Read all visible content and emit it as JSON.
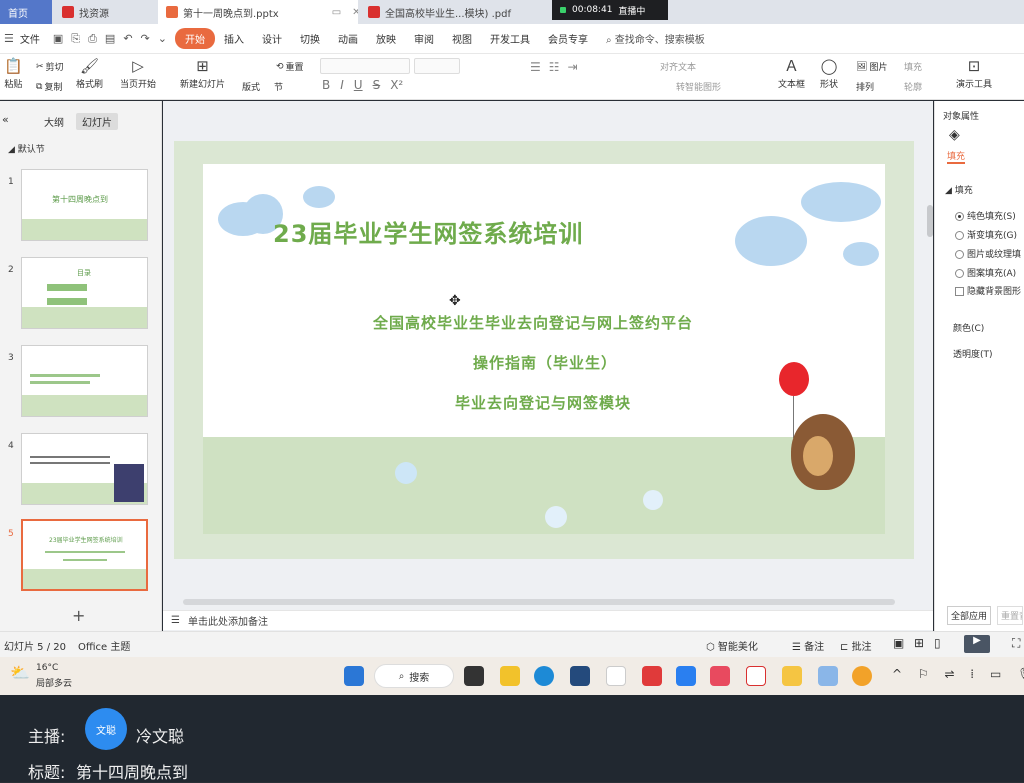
{
  "tabs": [
    {
      "label": "首页",
      "color": "#5477c9"
    },
    {
      "label": "找资源",
      "color": "#d9302f"
    },
    {
      "label": "第十一周晚点到.pptx",
      "color": "#e96a3f"
    },
    {
      "label": "全国高校毕业生...模块) .pdf",
      "color": "#d9302f"
    }
  ],
  "recording": {
    "time": "00:08:41",
    "status": "直播中"
  },
  "menubar": {
    "file": "文件",
    "items": [
      "开始",
      "插入",
      "设计",
      "切换",
      "动画",
      "放映",
      "审阅",
      "视图",
      "开发工具",
      "会员专享"
    ],
    "search": "查找命令、搜索模板"
  },
  "ribbon": {
    "paste": "粘贴",
    "cut": "剪切",
    "copy": "复制",
    "format_painter": "格式刷",
    "play_from_current": "当页开始",
    "new_slide": "新建幻灯片",
    "layout": "版式",
    "section": "节",
    "reset": "重置",
    "align_text": "对齐文本",
    "smart_graphic": "转智能图形",
    "textbox": "文本框",
    "shape": "形状",
    "picture": "图片",
    "arrange": "排列",
    "fill": "填充",
    "outline": "轮廓",
    "present_tools": "演示工具"
  },
  "left_panel": {
    "tab_outline": "大纲",
    "tab_slides": "幻灯片",
    "section": "默认节",
    "add": "+",
    "thumbs": [
      {
        "num": "1",
        "title": "第十四周晚点到"
      },
      {
        "num": "2",
        "title": "目录"
      },
      {
        "num": "3",
        "title": ""
      },
      {
        "num": "4",
        "title": ""
      },
      {
        "num": "5",
        "title": "23届毕业学生网签系统培训"
      }
    ]
  },
  "slide": {
    "title": "23届毕业学生网签系统培训",
    "line1": "全国高校毕业生毕业去向登记与网上签约平台",
    "line2": "操作指南（毕业生）",
    "line3": "毕业去向登记与网签模块"
  },
  "notes_placeholder": "单击此处添加备注",
  "right_panel": {
    "title": "对象属性",
    "tab": "填充",
    "section": "填充",
    "options": [
      "纯色填充(S)",
      "渐变填充(G)",
      "图片或纹理填",
      "图案填充(A)"
    ],
    "hide_bg": "隐藏背景图形",
    "color": "颜色(C)",
    "transparency": "透明度(T)",
    "apply_all": "全部应用",
    "reset": "重置背"
  },
  "status": {
    "slide_counter": "幻灯片 5 / 20",
    "theme": "Office 主题",
    "smart": "智能美化",
    "notes": "备注",
    "comments": "批注"
  },
  "taskbar": {
    "temp": "16°C",
    "weather": "局部多云",
    "search": "搜索"
  },
  "live": {
    "host_label": "主播:",
    "avatar_text": "文聪",
    "host_name": "冷文聪",
    "title_label": "标题:",
    "title": "第十四周晚点到"
  },
  "colors": {
    "accent": "#e96a3f",
    "slide_green": "#6fab4c",
    "cloud": "#b9d7f0",
    "grass": "#cfe1c2"
  }
}
